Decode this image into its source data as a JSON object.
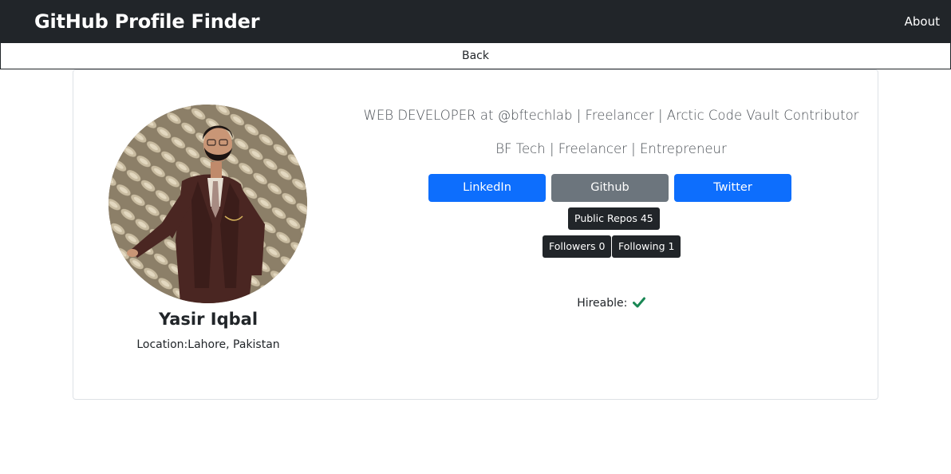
{
  "navbar": {
    "brand": "GitHub Profile Finder",
    "about_label": "About"
  },
  "back_label": "Back",
  "profile": {
    "name": "Yasir Iqbal",
    "location_label": "Location:",
    "location": "Lahore, Pakistan",
    "bio": "WEB DEVELOPER at @bftechlab | Freelancer | Arctic Code Vault Contributor",
    "company": "BF Tech | Freelancer | Entrepreneur",
    "links": {
      "linkedin": "LinkedIn",
      "github": "Github",
      "twitter": "Twitter"
    },
    "stats": {
      "public_repos": "Public Repos 45",
      "followers": "Followers 0",
      "following": "Following 1"
    },
    "hireable_label": "Hireable:",
    "hireable_icon": "check-icon"
  },
  "colors": {
    "navbar_bg": "#212529",
    "primary": "#0d6efd",
    "secondary": "#6c757d",
    "badge_bg": "#212529",
    "check": "#198754"
  }
}
